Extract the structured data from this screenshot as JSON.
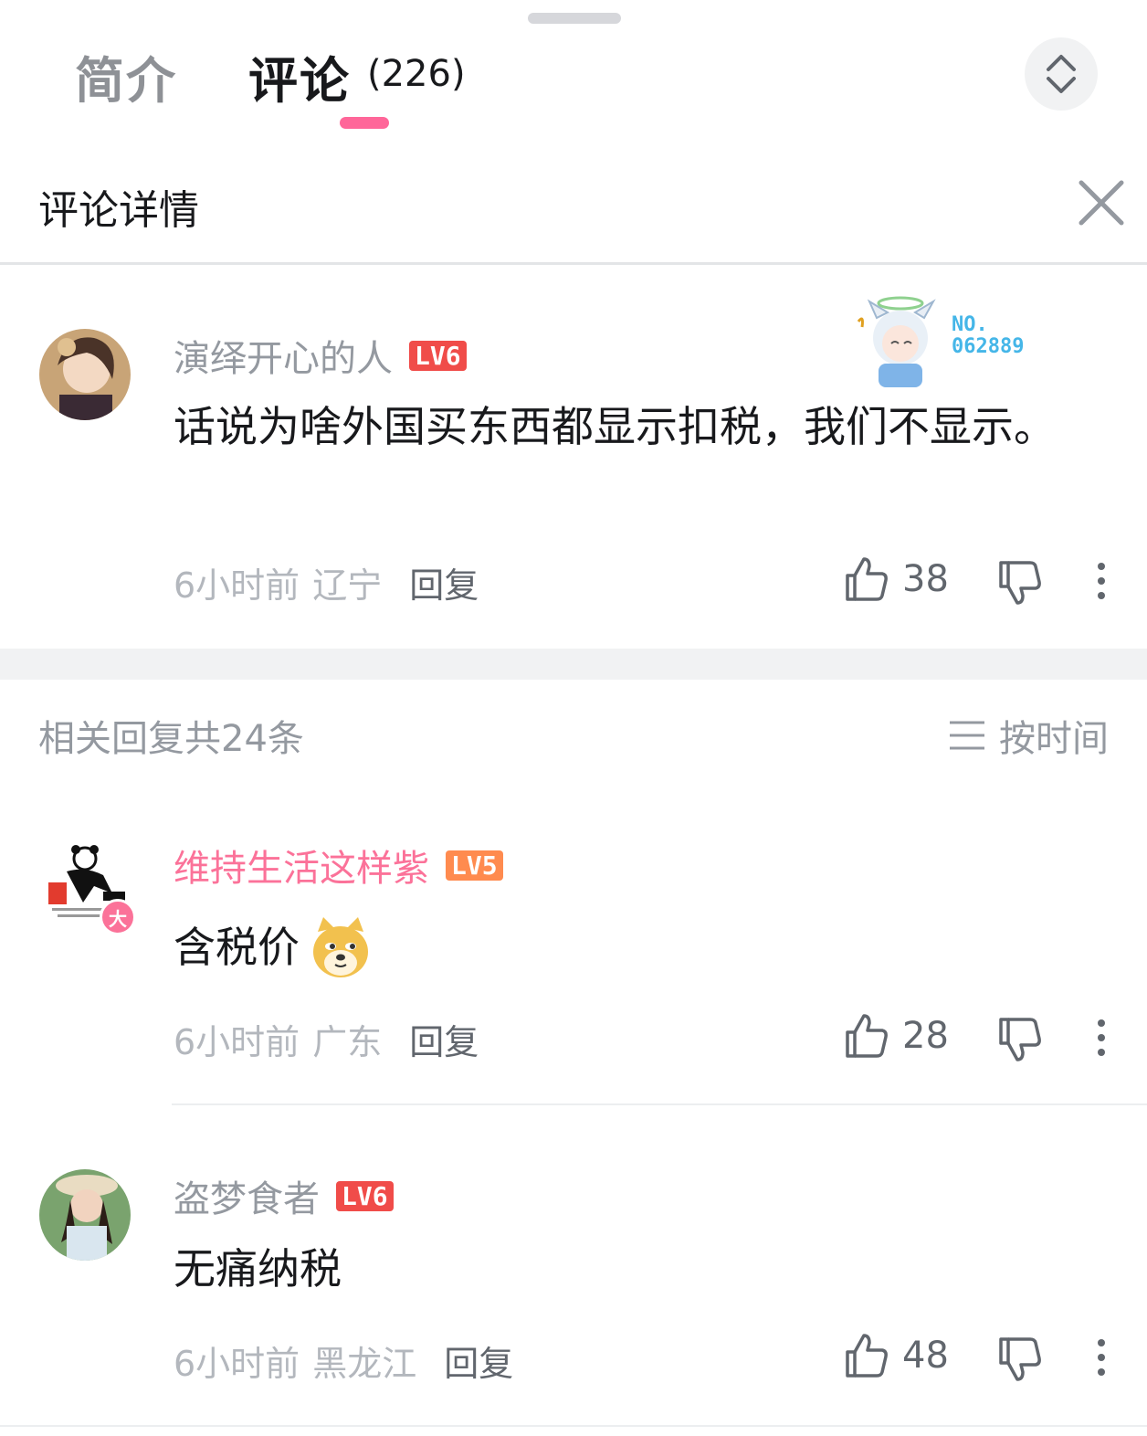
{
  "header": {
    "tabs": [
      {
        "label": "简介"
      },
      {
        "label": "评论",
        "count": "(226)"
      }
    ],
    "accent_color": "#ff6699"
  },
  "detail": {
    "title": "评论详情",
    "close_icon": "close-icon"
  },
  "main_comment": {
    "username": "演绎开心的人",
    "level": "LV6",
    "decoration_no": "NO.\n062889",
    "text": "话说为啥外国买东西都显示扣税，我们不显示。",
    "time": "6小时前",
    "location": "辽宁",
    "reply_label": "回复",
    "likes": "38"
  },
  "replies_header": {
    "count_text": "相关回复共24条",
    "sort_label": "按时间"
  },
  "replies": [
    {
      "username": "维持生活这样紫",
      "level": "LV5",
      "badge": "大",
      "text": "含税价",
      "time": "6小时前",
      "location": "广东",
      "reply_label": "回复",
      "likes": "28"
    },
    {
      "username": "盗梦食者",
      "level": "LV6",
      "text": "无痛纳税",
      "time": "6小时前",
      "location": "黑龙江",
      "reply_label": "回复",
      "likes": "48"
    }
  ]
}
